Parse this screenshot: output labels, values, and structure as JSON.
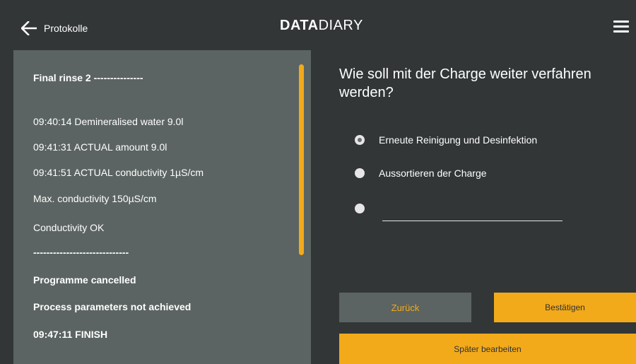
{
  "header": {
    "back_label": "Protokolle",
    "logo_bold": "DATA",
    "logo_light": "DIARY",
    "back_icon": "arrow-left-icon",
    "menu_icon": "hamburger-menu-icon"
  },
  "log": {
    "lines": [
      {
        "text": "Final rinse 2 ---------------",
        "bold": true
      },
      {
        "text": "09:40:14 Demineralised water 9.0l",
        "bold": false
      },
      {
        "text": "09:41:31 ACTUAL amount 9.0l",
        "bold": false
      },
      {
        "text": "09:41:51 ACTUAL conductivity 1µS/cm",
        "bold": false
      },
      {
        "text": "Max. conductivity 150µS/cm",
        "bold": false
      },
      {
        "text": "Conductivity OK",
        "bold": false
      },
      {
        "text": "-----------------------------",
        "bold": true
      },
      {
        "text": "Programme cancelled",
        "bold": true
      },
      {
        "text": "Process parameters not achieved",
        "bold": true
      },
      {
        "text": "09:47:11 FINISH",
        "bold": true
      }
    ]
  },
  "question": {
    "text": "Wie soll mit der Charge weiter verfahren werden?"
  },
  "options": [
    {
      "label": "Erneute Reinigung und Desinfektion",
      "selected": true
    },
    {
      "label": "Aussortieren der Charge",
      "selected": false
    },
    {
      "label": "",
      "selected": false,
      "custom": true
    }
  ],
  "custom_input": {
    "value": "",
    "placeholder": ""
  },
  "buttons": {
    "back": "Zurück",
    "confirm": "Bestätigen",
    "later": "Später bearbeiten"
  },
  "colors": {
    "accent": "#f2aa1b",
    "background": "#323637",
    "panel": "#5b6462"
  }
}
